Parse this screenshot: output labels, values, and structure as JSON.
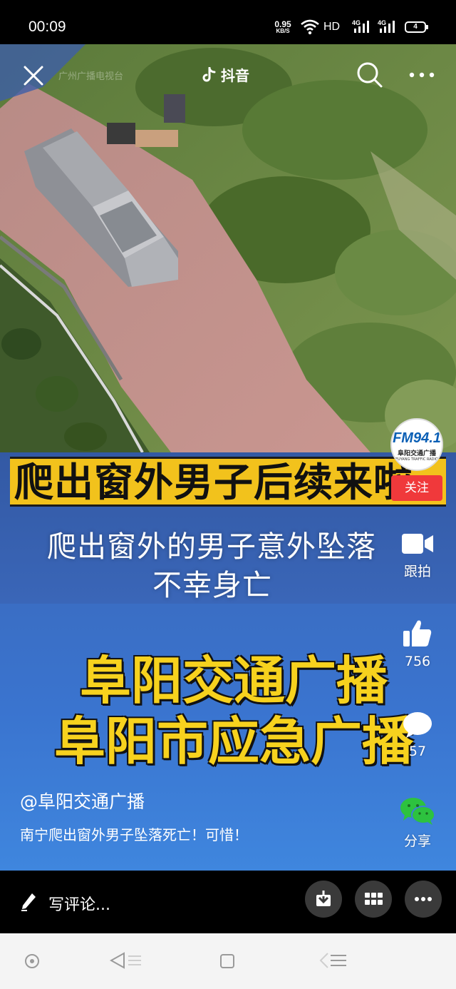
{
  "status_bar": {
    "time": "00:09",
    "net_speed": "0.95",
    "net_unit": "KB/S",
    "hd": "HD",
    "signal_1": "4G",
    "signal_2": "4G",
    "battery": "4"
  },
  "top_nav": {
    "source_watermark": "广州广播电视台",
    "app_name": "抖音"
  },
  "video": {
    "headline": "爬出窗外男子后续来啦",
    "subtitle_line1": "爬出窗外的男子意外坠落",
    "subtitle_line2": "不幸身亡",
    "banner_line1": "阜阳交通广播",
    "banner_line2": "阜阳市应急广播"
  },
  "right_rail": {
    "logo_main": "FM94.1",
    "logo_sub": "阜阳交通广播",
    "logo_en": "FUYANG TRAFFIC RADIO",
    "follow_label": "关注",
    "film_label": "跟拍",
    "like_count": "756",
    "comment_count": "57",
    "share_label": "分享"
  },
  "post": {
    "author": "@阜阳交通广播",
    "description": "南宁爬出窗外男子坠落死亡！可惜！"
  },
  "comment_bar": {
    "placeholder": "写评论..."
  },
  "colors": {
    "follow_red": "#f0393b",
    "caption_yellow": "#f2c21c",
    "panel_blue": "#3a74cf"
  },
  "icons": [
    "close-icon",
    "douyin-logo-icon",
    "search-icon",
    "more-icon",
    "camera-icon",
    "thumbs-up-icon",
    "comment-icon",
    "wechat-icon",
    "pen-icon",
    "download-icon",
    "grid-icon",
    "ellipsis-icon",
    "nav-home-icon",
    "nav-back-icon",
    "nav-recent-icon",
    "nav-menu-icon"
  ]
}
